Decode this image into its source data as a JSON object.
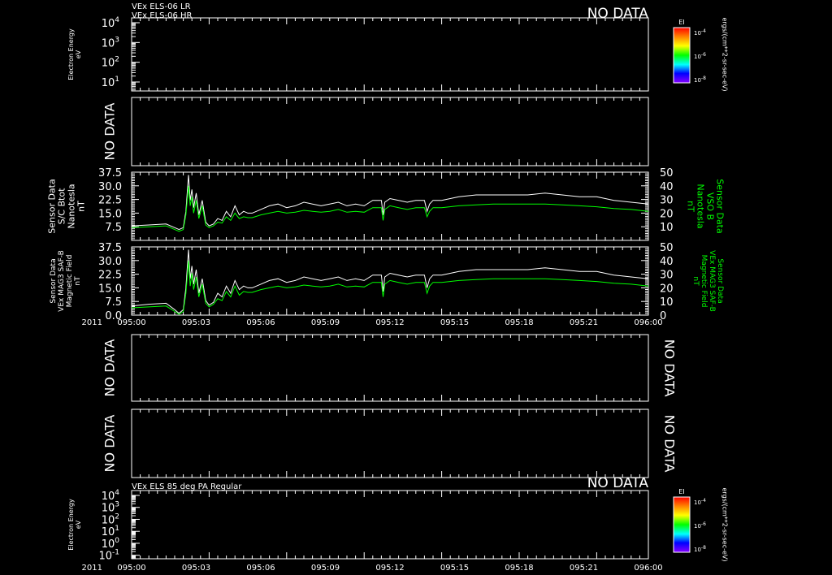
{
  "colors": {
    "background": "#000000",
    "axis": "#ffffff",
    "trace_white": "#ffffff",
    "trace_green": "#00ff00"
  },
  "time_axis": {
    "year": "2011",
    "ticks": [
      "095:00",
      "095:03",
      "095:06",
      "095:09",
      "095:12",
      "095:15",
      "095:18",
      "095:21",
      "096:00"
    ]
  },
  "panel1": {
    "title_lines": [
      "VEx ELS-06 LR",
      "VEx ELS-06 HR"
    ],
    "status": "NO DATA",
    "ylabel": [
      "Electron Energy",
      "eV"
    ],
    "ytick_mantissa": "10",
    "ytick_exps": [
      "4",
      "3",
      "2",
      "1"
    ],
    "colorbar": {
      "title": "EI",
      "tick_exps": [
        "-4",
        "-6",
        "-8"
      ]
    },
    "units": "ergs/(cm**2-sr-sec-eV)"
  },
  "panel2": {
    "status": "NO DATA"
  },
  "panel3": {
    "left_label": [
      "Sensor Data",
      "S/C Btot",
      "Nanotesla",
      "nT"
    ],
    "right_label": [
      "Sensor Data",
      "VSO B",
      "Nanotesla",
      "nT"
    ],
    "left_ticks": [
      "37.5",
      "30.0",
      "22.5",
      "15.0",
      "7.5"
    ],
    "right_ticks": [
      "50",
      "40",
      "30",
      "20",
      "10"
    ]
  },
  "panel4": {
    "left_label": [
      "Sensor Data",
      "VEx MAG3 SAF-B",
      "Magnetic Field",
      "nT"
    ],
    "right_label": [
      "Sensor Data",
      "VEx MAG3 SAF-B",
      "Magnetic Field",
      "nT"
    ],
    "left_ticks": [
      "37.5",
      "30.0",
      "22.5",
      "15.0",
      "7.5",
      "0.0"
    ],
    "right_ticks": [
      "50",
      "40",
      "30",
      "20",
      "10",
      "0"
    ]
  },
  "panel5": {
    "status_left": "NO DATA",
    "status_right": "NO DATA"
  },
  "panel6": {
    "status_left": "NO DATA",
    "status_right": "NO DATA"
  },
  "panel7": {
    "title": "VEx ELS 85 deg PA Regular",
    "status": "NO DATA",
    "ylabel": [
      "Electron Energy",
      "eV"
    ],
    "ytick_mantissa": "10",
    "ytick_exps": [
      "4",
      "3",
      "2",
      "1",
      "0",
      "-1"
    ],
    "colorbar": {
      "title": "EI",
      "tick_exps": [
        "-4",
        "-6",
        "-8"
      ]
    },
    "units": "ergs/(cm**2-sr-sec-eV)"
  },
  "chart_data": {
    "type": "line",
    "x_unit": "minutes after 095:00 (day:hour)",
    "x_range": [
      0,
      60
    ],
    "panels": [
      {
        "id": "panel3",
        "ylim": [
          0,
          37.5
        ],
        "series": [
          {
            "color": "#ffffff",
            "x": [
              0,
              2,
              4,
              5,
              5.5,
              6,
              6.3,
              6.6,
              6.8,
              7,
              7.2,
              7.5,
              7.8,
              8.2,
              8.6,
              9,
              9.5,
              10,
              10.5,
              11,
              11.5,
              12,
              12.5,
              13,
              13.5,
              14,
              15,
              16,
              17,
              18,
              19,
              20,
              21,
              22,
              23,
              24,
              25,
              26,
              27,
              28,
              29,
              29.2,
              29.4,
              30,
              31,
              32,
              33,
              34,
              34.3,
              34.6,
              35,
              36,
              38,
              40,
              42,
              44,
              46,
              48,
              50,
              52,
              54,
              56,
              58,
              60
            ],
            "y": [
              8,
              8.5,
              9,
              7,
              6,
              7,
              16,
              36,
              22,
              28,
              18,
              26,
              14,
              22,
              10,
              8,
              9,
              12,
              11,
              16,
              13,
              19,
              14,
              16,
              15,
              15,
              17,
              19,
              20,
              18,
              19,
              21,
              20,
              19,
              20,
              21,
              19,
              20,
              19,
              22,
              22,
              14,
              21,
              23,
              22,
              21,
              22,
              22,
              16,
              20,
              22,
              22,
              24,
              25,
              25,
              25,
              25,
              26,
              25,
              24,
              24,
              22,
              21,
              20
            ]
          },
          {
            "color": "#00ff00",
            "x": [
              0,
              2,
              4,
              5,
              5.5,
              6,
              6.3,
              6.6,
              6.8,
              7,
              7.2,
              7.5,
              7.8,
              8.2,
              8.6,
              9,
              9.5,
              10,
              10.5,
              11,
              11.5,
              12,
              12.5,
              13,
              13.5,
              14,
              15,
              16,
              17,
              18,
              19,
              20,
              21,
              22,
              23,
              24,
              25,
              26,
              27,
              28,
              29,
              29.2,
              29.4,
              30,
              31,
              32,
              33,
              34,
              34.3,
              34.6,
              35,
              36,
              38,
              40,
              42,
              44,
              46,
              48,
              50,
              52,
              54,
              56,
              58,
              60
            ],
            "y": [
              7,
              7.5,
              8,
              6,
              5,
              6,
              14,
              30,
              19,
              24,
              15,
              22,
              12,
              19,
              8.5,
              7,
              8,
              10,
              9.5,
              13,
              11,
              15,
              12,
              13,
              12.5,
              12.5,
              14,
              15,
              16,
              15,
              15.5,
              16.5,
              16,
              15.5,
              16,
              17,
              15.5,
              16,
              15.5,
              18,
              18,
              11,
              17,
              19,
              18,
              17,
              18,
              18,
              13,
              16,
              18,
              18,
              19,
              19.5,
              20,
              20,
              20,
              20,
              19.5,
              19,
              18.5,
              17.5,
              17,
              16
            ]
          }
        ]
      },
      {
        "id": "panel4",
        "ylim": [
          0,
          37.5
        ],
        "series": [
          {
            "color": "#ffffff",
            "x": [
              0,
              2,
              4,
              5,
              5.5,
              6,
              6.3,
              6.6,
              6.8,
              7,
              7.2,
              7.5,
              7.8,
              8.2,
              8.6,
              9,
              9.5,
              10,
              10.5,
              11,
              11.5,
              12,
              12.5,
              13,
              13.5,
              14,
              15,
              16,
              17,
              18,
              19,
              20,
              21,
              22,
              23,
              24,
              25,
              26,
              27,
              28,
              29,
              29.2,
              29.4,
              30,
              31,
              32,
              33,
              34,
              34.3,
              34.6,
              35,
              36,
              38,
              40,
              42,
              44,
              46,
              48,
              50,
              52,
              54,
              56,
              58,
              60
            ],
            "y": [
              5,
              6,
              6.5,
              3,
              1,
              3,
              15,
              36,
              20,
              27,
              17,
              25,
              12,
              20,
              8,
              5.5,
              7,
              12,
              10,
              16,
              12,
              19,
              14,
              16,
              15,
              15,
              17,
              19,
              20,
              18,
              19,
              21,
              20,
              19,
              20,
              21,
              19,
              20,
              19,
              22,
              22,
              13,
              21,
              23,
              22,
              21,
              22,
              22,
              15,
              20,
              22,
              22,
              24,
              25,
              25,
              25,
              25,
              26,
              25,
              24,
              24,
              22,
              21,
              20
            ]
          },
          {
            "color": "#00ff00",
            "x": [
              0,
              2,
              4,
              5,
              5.5,
              6,
              6.3,
              6.6,
              6.8,
              7,
              7.2,
              7.5,
              7.8,
              8.2,
              8.6,
              9,
              9.5,
              10,
              10.5,
              11,
              11.5,
              12,
              12.5,
              13,
              13.5,
              14,
              15,
              16,
              17,
              18,
              19,
              20,
              21,
              22,
              23,
              24,
              25,
              26,
              27,
              28,
              29,
              29.2,
              29.4,
              30,
              31,
              32,
              33,
              34,
              34.3,
              34.6,
              35,
              36,
              38,
              40,
              42,
              44,
              46,
              48,
              50,
              52,
              54,
              56,
              58,
              60
            ],
            "y": [
              4,
              4.5,
              5,
              2,
              0.5,
              2,
              12,
              30,
              16,
              23,
              14,
              21,
              10,
              17,
              6.5,
              4.5,
              6,
              9,
              8,
              13,
              10,
              16,
              11,
              13,
              12.5,
              12.5,
              14,
              15,
              16,
              15,
              15.5,
              16.5,
              16,
              15.5,
              16,
              17,
              15.5,
              16,
              15.5,
              18,
              18,
              10,
              17,
              19,
              18,
              17,
              18,
              18,
              12,
              16,
              18,
              18,
              19,
              19.5,
              20,
              20,
              20,
              20,
              19.5,
              19,
              18.5,
              17.5,
              17,
              16
            ]
          }
        ]
      }
    ]
  }
}
